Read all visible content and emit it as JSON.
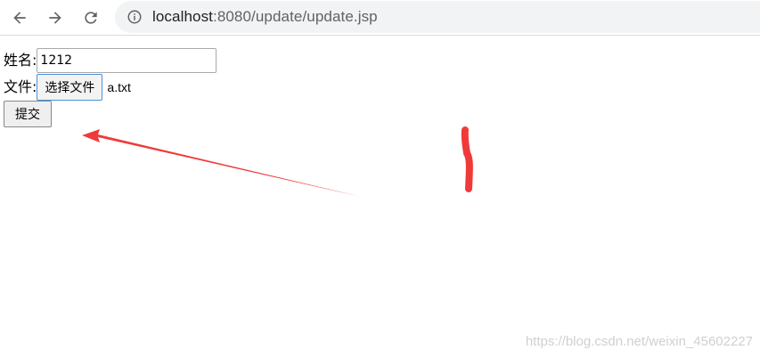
{
  "browser": {
    "url_host": "localhost",
    "url_path": ":8080/update/update.jsp"
  },
  "form": {
    "name_label": "姓名:",
    "name_value": "1212",
    "file_label": "文件:",
    "file_button_label": "选择文件",
    "file_name": "a.txt",
    "submit_label": "提交"
  },
  "annotation": {
    "color": "#f03a3a"
  },
  "watermark": "https://blog.csdn.net/weixin_45602227"
}
